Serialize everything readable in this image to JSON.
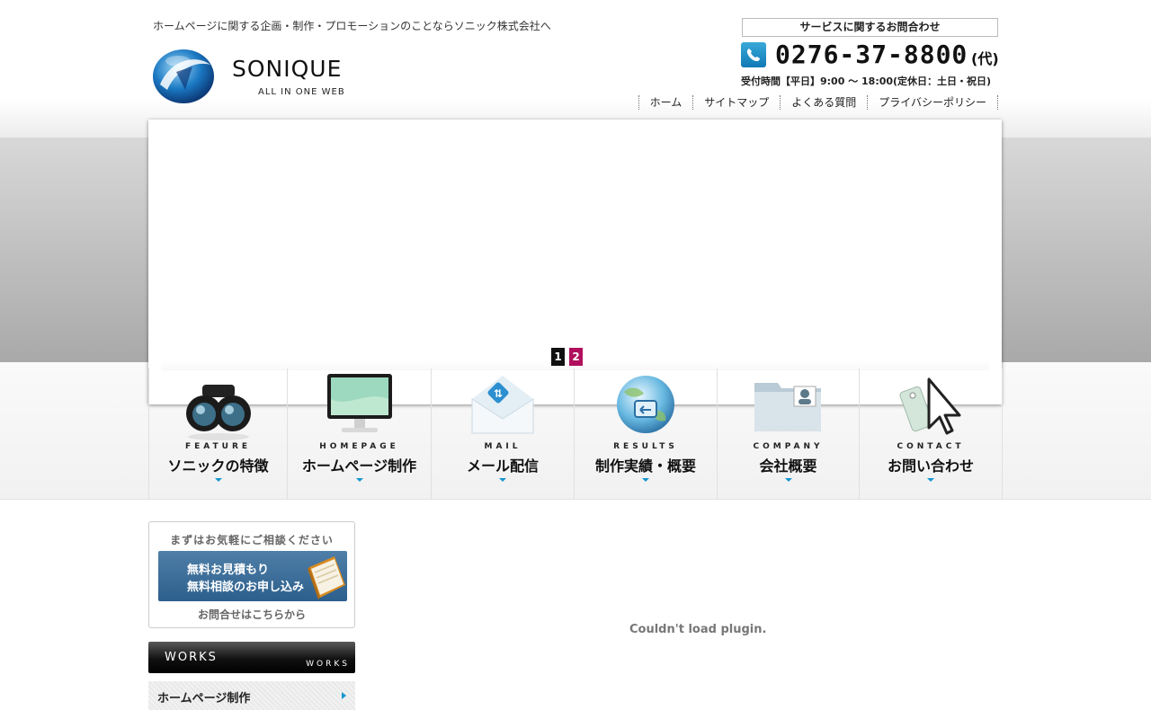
{
  "header": {
    "tagline": "ホームページに関する企画・制作・プロモーションのことならソニック株式会社へ",
    "logo_text": "SONIQUE",
    "logo_sub": "ALL IN ONE WEB",
    "contact_label": "サービスに関するお問合わせ",
    "phone_number": "0276-37-8800",
    "phone_suffix": "(代)",
    "hours": "受付時間【平日】9:00 〜 18:00(定休日：土日・祝日)",
    "phone_icon": "phone-icon",
    "util_nav": [
      {
        "label": "ホーム"
      },
      {
        "label": "サイトマップ"
      },
      {
        "label": "よくある質問"
      },
      {
        "label": "プライバシーポリシー"
      }
    ]
  },
  "slideshow": {
    "pages": [
      "1",
      "2"
    ],
    "active_page": "2",
    "active_color": "#b0105c"
  },
  "main_nav": [
    {
      "en": "FEATURE",
      "jp": "ソニックの特徴",
      "icon": "binoculars-icon"
    },
    {
      "en": "HOMEPAGE",
      "jp": "ホームページ制作",
      "icon": "monitor-icon"
    },
    {
      "en": "MAIL",
      "jp": "メール配信",
      "icon": "mail-envelope-icon"
    },
    {
      "en": "RESULTS",
      "jp": "制作実績・概要",
      "icon": "globe-icon"
    },
    {
      "en": "COMPANY",
      "jp": "会社概要",
      "icon": "folder-icon"
    },
    {
      "en": "CONTACT",
      "jp": "お問い合わせ",
      "icon": "cursor-tag-icon"
    }
  ],
  "sidebar": {
    "consult_top": "まずはお気軽にご相談ください",
    "consult_line1": "無料お見積もり",
    "consult_line2": "無料相談のお申し込み",
    "consult_bottom": "お問合せはこちらから",
    "works_title": "WORKS",
    "works_sub": "WORKS",
    "links": [
      {
        "label": "ホームページ制作"
      }
    ]
  },
  "content": {
    "plugin_message": "Couldn't load plugin."
  },
  "colors": {
    "accent_blue": "#1596cf",
    "pager_active": "#b0105c",
    "consult_blue": "#3a6a96"
  }
}
